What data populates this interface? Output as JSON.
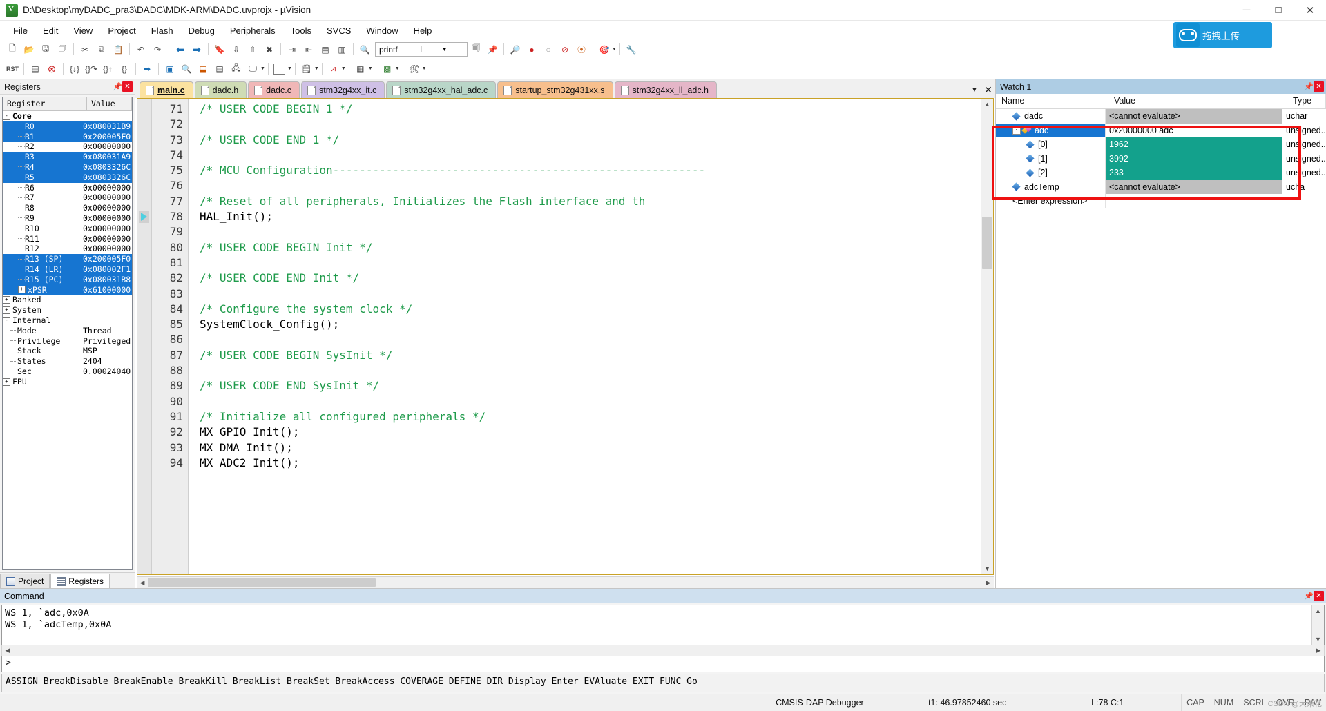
{
  "window": {
    "title": "D:\\Desktop\\myDADC_pra3\\DADC\\MDK-ARM\\DADC.uvprojx - µVision",
    "app_icon": "uvision-icon",
    "minimize": "─",
    "maximize": "□",
    "close": "✕"
  },
  "menu": {
    "items": [
      "File",
      "Edit",
      "View",
      "Project",
      "Flash",
      "Debug",
      "Peripherals",
      "Tools",
      "SVCS",
      "Window",
      "Help"
    ],
    "upload_button": {
      "label": "拖拽上传",
      "icon": "glasses-icon",
      "color": "#1e9bde"
    }
  },
  "toolbar1": {
    "combo_value": "printf",
    "icons": [
      "new-file-icon",
      "open-folder-icon",
      "save-icon",
      "save-all-icon",
      "cut-icon",
      "copy-icon",
      "paste-icon",
      "undo-icon",
      "redo-icon",
      "nav-back-icon",
      "nav-forward-icon",
      "bookmark-icon",
      "bookmark-next-icon",
      "bookmark-prev-icon",
      "bookmark-clear-icon",
      "indent-icon",
      "outdent-icon",
      "comment-icon",
      "uncomment-icon",
      "find-icon",
      "breakpoint-icon",
      "breakpoint-disable-icon",
      "breakpoint-kill-icon",
      "breakpoint-toggle-icon",
      "target-options-icon",
      "configure-icon"
    ]
  },
  "toolbar2": {
    "icons": [
      "reset-icon",
      "run-icon",
      "stop-icon",
      "step-into-icon",
      "step-over-icon",
      "step-out-icon",
      "run-to-cursor-icon",
      "show-statement-icon",
      "disassembly-icon",
      "symbols-icon",
      "registers-window-icon",
      "call-stack-icon",
      "watch-window-icon",
      "memory-window-icon",
      "serial-window-icon",
      "analysis-window-icon",
      "trace-icon",
      "system-viewer-icon",
      "toolbox-icon"
    ],
    "reset_label": "RST"
  },
  "registers_pane": {
    "title": "Registers",
    "pin_icon": "pin-icon",
    "close_icon": "close-icon",
    "columns": [
      "Register",
      "Value"
    ],
    "rows": [
      {
        "name": "Core",
        "value": "",
        "depth": 0,
        "toggle": "-",
        "bold": true,
        "selected": false
      },
      {
        "name": "R0",
        "value": "0x080031B9",
        "depth": 2,
        "toggle": "",
        "bold": false,
        "selected": true
      },
      {
        "name": "R1",
        "value": "0x200005F0",
        "depth": 2,
        "toggle": "",
        "bold": false,
        "selected": true
      },
      {
        "name": "R2",
        "value": "0x00000000",
        "depth": 2,
        "toggle": "",
        "bold": false,
        "selected": false
      },
      {
        "name": "R3",
        "value": "0x080031A9",
        "depth": 2,
        "toggle": "",
        "bold": false,
        "selected": true
      },
      {
        "name": "R4",
        "value": "0x0803326C",
        "depth": 2,
        "toggle": "",
        "bold": false,
        "selected": true
      },
      {
        "name": "R5",
        "value": "0x0803326C",
        "depth": 2,
        "toggle": "",
        "bold": false,
        "selected": true
      },
      {
        "name": "R6",
        "value": "0x00000000",
        "depth": 2,
        "toggle": "",
        "bold": false,
        "selected": false
      },
      {
        "name": "R7",
        "value": "0x00000000",
        "depth": 2,
        "toggle": "",
        "bold": false,
        "selected": false
      },
      {
        "name": "R8",
        "value": "0x00000000",
        "depth": 2,
        "toggle": "",
        "bold": false,
        "selected": false
      },
      {
        "name": "R9",
        "value": "0x00000000",
        "depth": 2,
        "toggle": "",
        "bold": false,
        "selected": false
      },
      {
        "name": "R10",
        "value": "0x00000000",
        "depth": 2,
        "toggle": "",
        "bold": false,
        "selected": false
      },
      {
        "name": "R11",
        "value": "0x00000000",
        "depth": 2,
        "toggle": "",
        "bold": false,
        "selected": false
      },
      {
        "name": "R12",
        "value": "0x00000000",
        "depth": 2,
        "toggle": "",
        "bold": false,
        "selected": false
      },
      {
        "name": "R13 (SP)",
        "value": "0x200005F0",
        "depth": 2,
        "toggle": "",
        "bold": false,
        "selected": true
      },
      {
        "name": "R14 (LR)",
        "value": "0x080002F1",
        "depth": 2,
        "toggle": "",
        "bold": false,
        "selected": true
      },
      {
        "name": "R15 (PC)",
        "value": "0x080031B8",
        "depth": 2,
        "toggle": "",
        "bold": false,
        "selected": true
      },
      {
        "name": "xPSR",
        "value": "0x61000000",
        "depth": 2,
        "toggle": "+",
        "bold": false,
        "selected": true
      },
      {
        "name": "Banked",
        "value": "",
        "depth": 0,
        "toggle": "+",
        "bold": false,
        "selected": false
      },
      {
        "name": "System",
        "value": "",
        "depth": 0,
        "toggle": "+",
        "bold": false,
        "selected": false
      },
      {
        "name": "Internal",
        "value": "",
        "depth": 0,
        "toggle": "-",
        "bold": false,
        "selected": false
      },
      {
        "name": "Mode",
        "value": "Thread",
        "depth": 1,
        "toggle": "",
        "bold": false,
        "selected": false
      },
      {
        "name": "Privilege",
        "value": "Privileged",
        "depth": 1,
        "toggle": "",
        "bold": false,
        "selected": false
      },
      {
        "name": "Stack",
        "value": "MSP",
        "depth": 1,
        "toggle": "",
        "bold": false,
        "selected": false
      },
      {
        "name": "States",
        "value": "2404",
        "depth": 1,
        "toggle": "",
        "bold": false,
        "selected": false
      },
      {
        "name": "Sec",
        "value": "0.00024040",
        "depth": 1,
        "toggle": "",
        "bold": false,
        "selected": false
      },
      {
        "name": "FPU",
        "value": "",
        "depth": 0,
        "toggle": "+",
        "bold": false,
        "selected": false
      }
    ],
    "bottom_tabs": [
      {
        "label": "Project",
        "icon": "project-icon",
        "active": false
      },
      {
        "label": "Registers",
        "icon": "registers-icon",
        "active": true
      }
    ]
  },
  "editor": {
    "tabs": [
      {
        "label": "main.c",
        "color": "#fbe2a0",
        "active": true
      },
      {
        "label": "dadc.h",
        "color": "#cfdcb5",
        "active": false
      },
      {
        "label": "dadc.c",
        "color": "#f0b7b7",
        "active": false
      },
      {
        "label": "stm32g4xx_it.c",
        "color": "#cfc0e6",
        "active": false
      },
      {
        "label": "stm32g4xx_hal_adc.c",
        "color": "#b9d6c8",
        "active": false
      },
      {
        "label": "startup_stm32g431xx.s",
        "color": "#f7bf8d",
        "active": false
      },
      {
        "label": "stm32g4xx_ll_adc.h",
        "color": "#e5b6c8",
        "active": false
      }
    ],
    "tab_dropdown_icon": "chevron-down-icon",
    "tab_close_icon": "close-icon",
    "first_line_number": 71,
    "lines": [
      {
        "n": 71,
        "text": "/* USER CODE BEGIN 1 */",
        "comment": true,
        "exec": false
      },
      {
        "n": 72,
        "text": "",
        "comment": false,
        "exec": false
      },
      {
        "n": 73,
        "text": "/* USER CODE END 1 */",
        "comment": true,
        "exec": false
      },
      {
        "n": 74,
        "text": "",
        "comment": false,
        "exec": false
      },
      {
        "n": 75,
        "text": "/* MCU Configuration--------------------------------------------------------",
        "comment": true,
        "exec": false
      },
      {
        "n": 76,
        "text": "",
        "comment": false,
        "exec": false
      },
      {
        "n": 77,
        "text": "/* Reset of all peripherals, Initializes the Flash interface and th",
        "comment": true,
        "exec": false
      },
      {
        "n": 78,
        "text": "HAL_Init();",
        "comment": false,
        "exec": true
      },
      {
        "n": 79,
        "text": "",
        "comment": false,
        "exec": false
      },
      {
        "n": 80,
        "text": "/* USER CODE BEGIN Init */",
        "comment": true,
        "exec": false
      },
      {
        "n": 81,
        "text": "",
        "comment": false,
        "exec": false
      },
      {
        "n": 82,
        "text": "/* USER CODE END Init */",
        "comment": true,
        "exec": false
      },
      {
        "n": 83,
        "text": "",
        "comment": false,
        "exec": false
      },
      {
        "n": 84,
        "text": "/* Configure the system clock */",
        "comment": true,
        "exec": false
      },
      {
        "n": 85,
        "text": "SystemClock_Config();",
        "comment": false,
        "exec": false
      },
      {
        "n": 86,
        "text": "",
        "comment": false,
        "exec": false
      },
      {
        "n": 87,
        "text": "/* USER CODE BEGIN SysInit */",
        "comment": true,
        "exec": false
      },
      {
        "n": 88,
        "text": "",
        "comment": false,
        "exec": false
      },
      {
        "n": 89,
        "text": "/* USER CODE END SysInit */",
        "comment": true,
        "exec": false
      },
      {
        "n": 90,
        "text": "",
        "comment": false,
        "exec": false
      },
      {
        "n": 91,
        "text": "/* Initialize all configured peripherals */",
        "comment": true,
        "exec": false
      },
      {
        "n": 92,
        "text": "MX_GPIO_Init();",
        "comment": false,
        "exec": false
      },
      {
        "n": 93,
        "text": "MX_DMA_Init();",
        "comment": false,
        "exec": false
      },
      {
        "n": 94,
        "text": "MX_ADC2_Init();",
        "comment": false,
        "exec": false
      }
    ]
  },
  "watch": {
    "title": "Watch 1",
    "pin_icon": "pin-icon",
    "close_icon": "close-icon",
    "columns": [
      "Name",
      "Value",
      "Type"
    ],
    "rows": [
      {
        "name": "dadc",
        "value": "<cannot evaluate>",
        "type": "uchar",
        "icon": "blue-diamond-icon",
        "depth": 1,
        "toggle": "",
        "selected": false,
        "value_style": "gray"
      },
      {
        "name": "adc",
        "value": "0x20000000 adc",
        "type": "unsigned...",
        "icon": "multi-diamond-icon",
        "depth": 1,
        "toggle": "-",
        "selected": true,
        "value_style": "plain"
      },
      {
        "name": "[0]",
        "value": "1962",
        "type": "unsigned...",
        "icon": "blue-diamond-icon",
        "depth": 2,
        "toggle": "",
        "selected": false,
        "value_style": "teal"
      },
      {
        "name": "[1]",
        "value": "3992",
        "type": "unsigned...",
        "icon": "blue-diamond-icon",
        "depth": 2,
        "toggle": "",
        "selected": false,
        "value_style": "teal"
      },
      {
        "name": "[2]",
        "value": "233",
        "type": "unsigned...",
        "icon": "blue-diamond-icon",
        "depth": 2,
        "toggle": "",
        "selected": false,
        "value_style": "teal"
      },
      {
        "name": "adcTemp",
        "value": "<cannot evaluate>",
        "type": "ucha",
        "icon": "blue-diamond-icon",
        "depth": 1,
        "toggle": "",
        "selected": false,
        "value_style": "gray"
      },
      {
        "name": "<Enter expression>",
        "value": "",
        "type": "",
        "icon": "none",
        "depth": 1,
        "toggle": "",
        "selected": false,
        "value_style": "plain"
      }
    ],
    "highlight_color": "#ee1111"
  },
  "command": {
    "title": "Command",
    "pin_icon": "pin-icon",
    "close_icon": "close-icon",
    "output_lines": [
      "WS 1, `adc,0x0A",
      "WS 1, `adcTemp,0x0A"
    ],
    "prompt": ">",
    "input_value": "",
    "keywords": "ASSIGN BreakDisable BreakEnable BreakKill BreakList BreakSet BreakAccess COVERAGE DEFINE DIR Display Enter EVAluate EXIT FUNC Go"
  },
  "statusbar": {
    "debugger": "CMSIS-DAP Debugger",
    "time": "t1: 46.97852460 sec",
    "cursor": "L:78 C:1",
    "indicators": [
      "CAP",
      "NUM",
      "SCRL",
      "OVR",
      "R/W"
    ],
    "watermark": "CSDN @大茉花"
  }
}
